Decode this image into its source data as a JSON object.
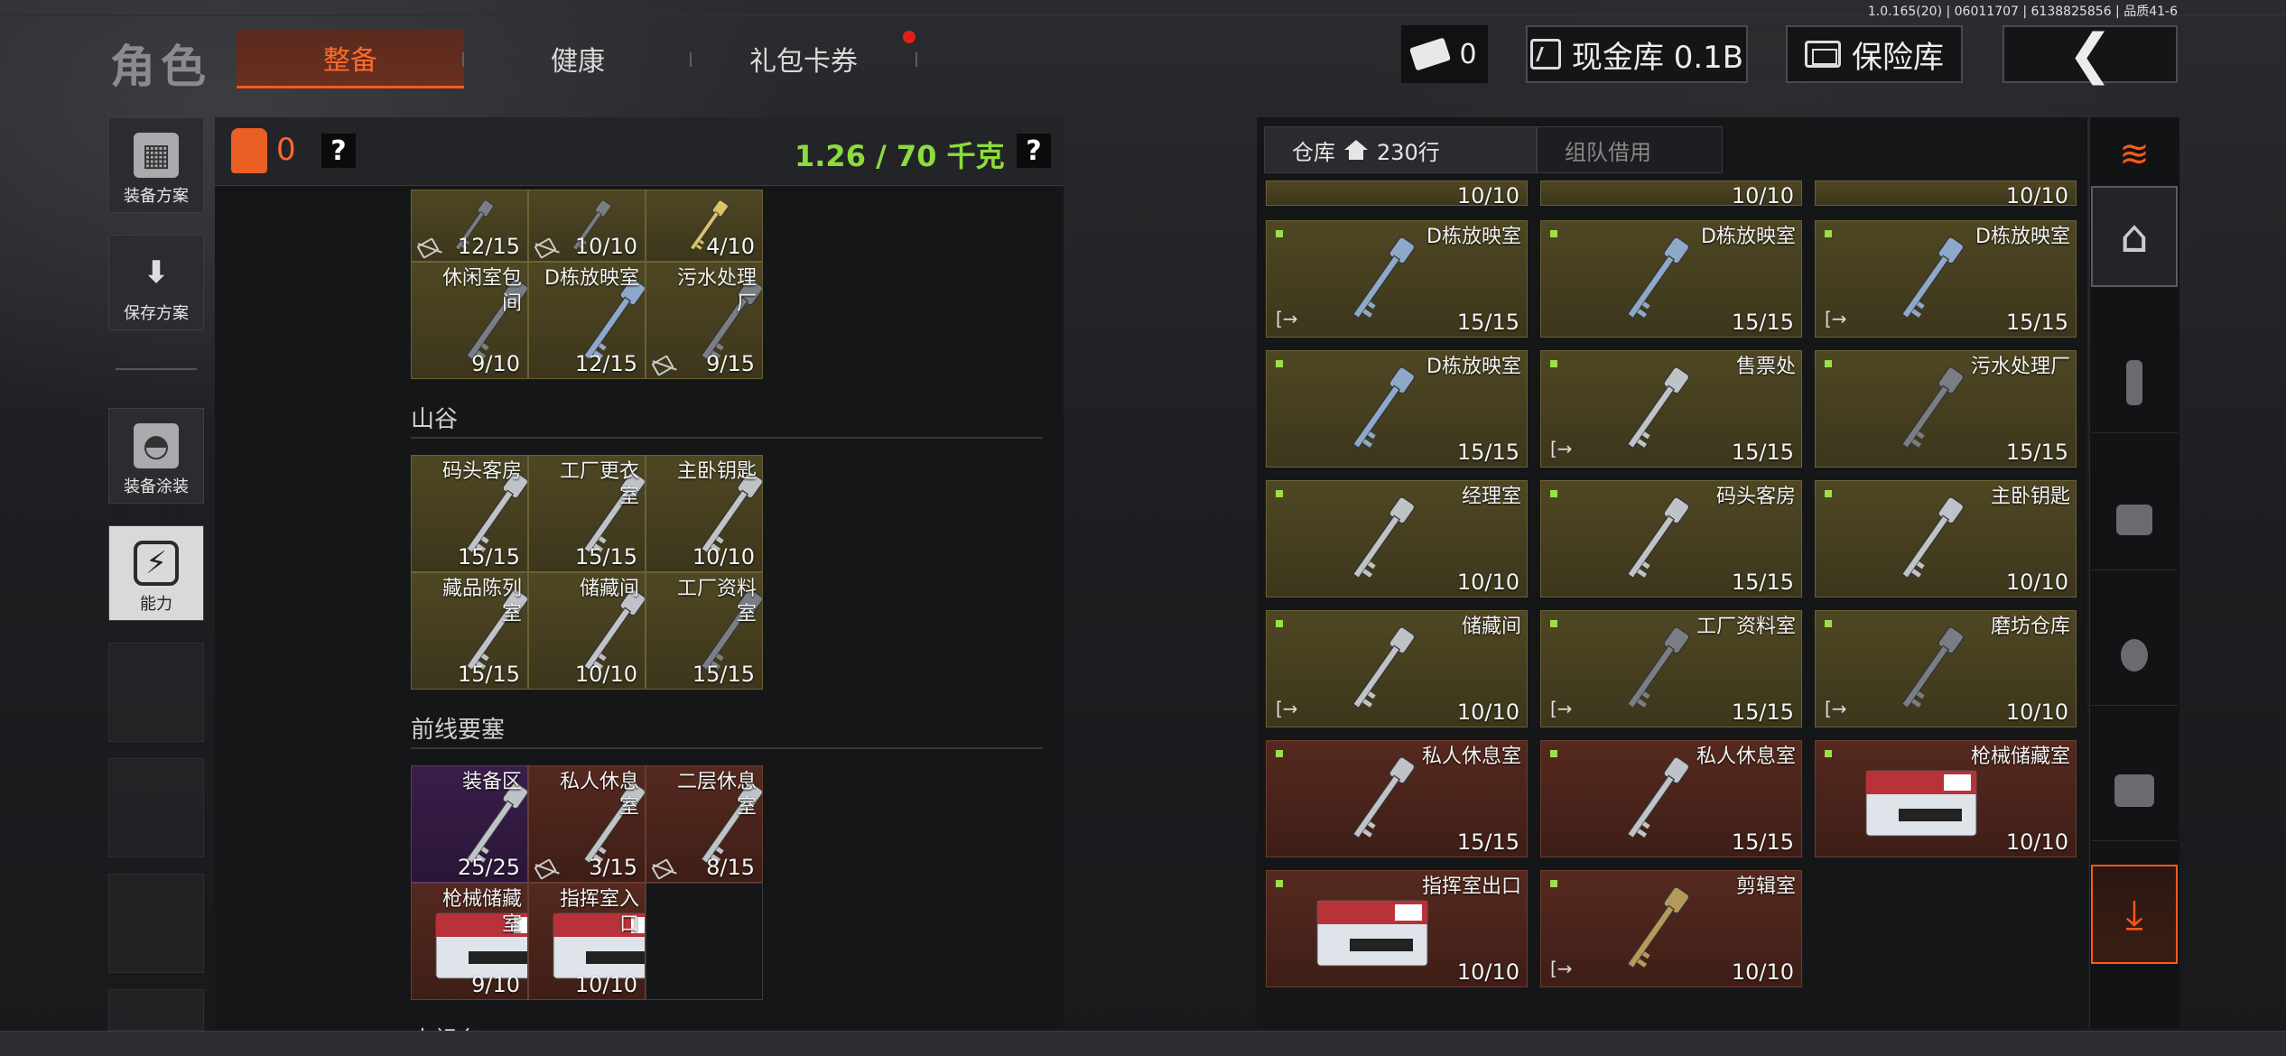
{
  "version": "1.0.165(20) | 06011707 | 6138825856 | 品质41-6",
  "header": {
    "title": "角色",
    "tabs": [
      {
        "label": "整备",
        "active": true
      },
      {
        "label": "健康",
        "active": false
      },
      {
        "label": "礼包卡券",
        "active": false,
        "notification": true
      }
    ],
    "currency_count": "0",
    "vault_label": "现金库 0.1B",
    "insurance_label": "保险库"
  },
  "sidebar": {
    "items": [
      {
        "label": "装备方案",
        "icon": "vest-icon"
      },
      {
        "label": "保存方案",
        "icon": "download-icon"
      },
      {
        "label": "装备涂装",
        "icon": "helmet-icon"
      },
      {
        "label": "能力",
        "icon": "ability-icon"
      }
    ]
  },
  "loadout": {
    "vest_count": "0",
    "help": "?",
    "weight": "1.26 / 70 千克",
    "top_keys": [
      {
        "count": "12/15"
      },
      {
        "count": "10/10"
      },
      {
        "count": "4/10"
      }
    ],
    "top_keys_row2": [
      {
        "name": "休闲室包\n间",
        "count": "9/10"
      },
      {
        "name": "D栋放映室",
        "count": "12/15"
      },
      {
        "name": "污水处理\n厂",
        "count": "9/15"
      }
    ],
    "sections": [
      {
        "title": "山谷",
        "keys": [
          {
            "name": "码头客房",
            "count": "15/15"
          },
          {
            "name": "工厂更衣\n室",
            "count": "15/15"
          },
          {
            "name": "主卧钥匙",
            "count": "10/10"
          },
          {
            "name": "藏品陈列\n室",
            "count": "15/15"
          },
          {
            "name": "储藏间",
            "count": "10/10"
          },
          {
            "name": "工厂资料\n室",
            "count": "15/15"
          }
        ]
      },
      {
        "title": "前线要塞",
        "keys": [
          {
            "name": "装备区",
            "count": "25/25"
          },
          {
            "name": "私人休息\n室",
            "count": "3/15"
          },
          {
            "name": "二层休息\n室",
            "count": "8/15"
          },
          {
            "name": "枪械储藏\n室",
            "count": "9/10"
          },
          {
            "name": "指挥室入\n口",
            "count": "10/10"
          }
        ]
      },
      {
        "title": "中祖台"
      }
    ]
  },
  "warehouse": {
    "tab_label": "仓库",
    "rows_label": "230行",
    "tab2_label": "组队借用",
    "partial_counts": [
      "10/10",
      "10/10",
      "10/10"
    ],
    "items": [
      {
        "name": "D栋放映室",
        "count": "15/15"
      },
      {
        "name": "D栋放映室",
        "count": "15/15"
      },
      {
        "name": "D栋放映室",
        "count": "15/15"
      },
      {
        "name": "D栋放映室",
        "count": "15/15"
      },
      {
        "name": "售票处",
        "count": "15/15"
      },
      {
        "name": "污水处理厂",
        "count": "15/15"
      },
      {
        "name": "经理室",
        "count": "10/10"
      },
      {
        "name": "码头客房",
        "count": "15/15"
      },
      {
        "name": "主卧钥匙",
        "count": "10/10"
      },
      {
        "name": "储藏间",
        "count": "10/10"
      },
      {
        "name": "工厂资料室",
        "count": "15/15"
      },
      {
        "name": "磨坊仓库",
        "count": "10/10"
      },
      {
        "name": "私人休息室",
        "count": "15/15"
      },
      {
        "name": "私人休息室",
        "count": "15/15"
      },
      {
        "name": "枪械储藏室",
        "count": "10/10"
      },
      {
        "name": "指挥室出口",
        "count": "10/10"
      },
      {
        "name": "剪辑室",
        "count": "10/10"
      }
    ]
  },
  "colors": {
    "accent": "#ff5a1a",
    "weight": "#8bdc3c",
    "gold_card": "#4f4723",
    "red_card": "#55291f"
  }
}
